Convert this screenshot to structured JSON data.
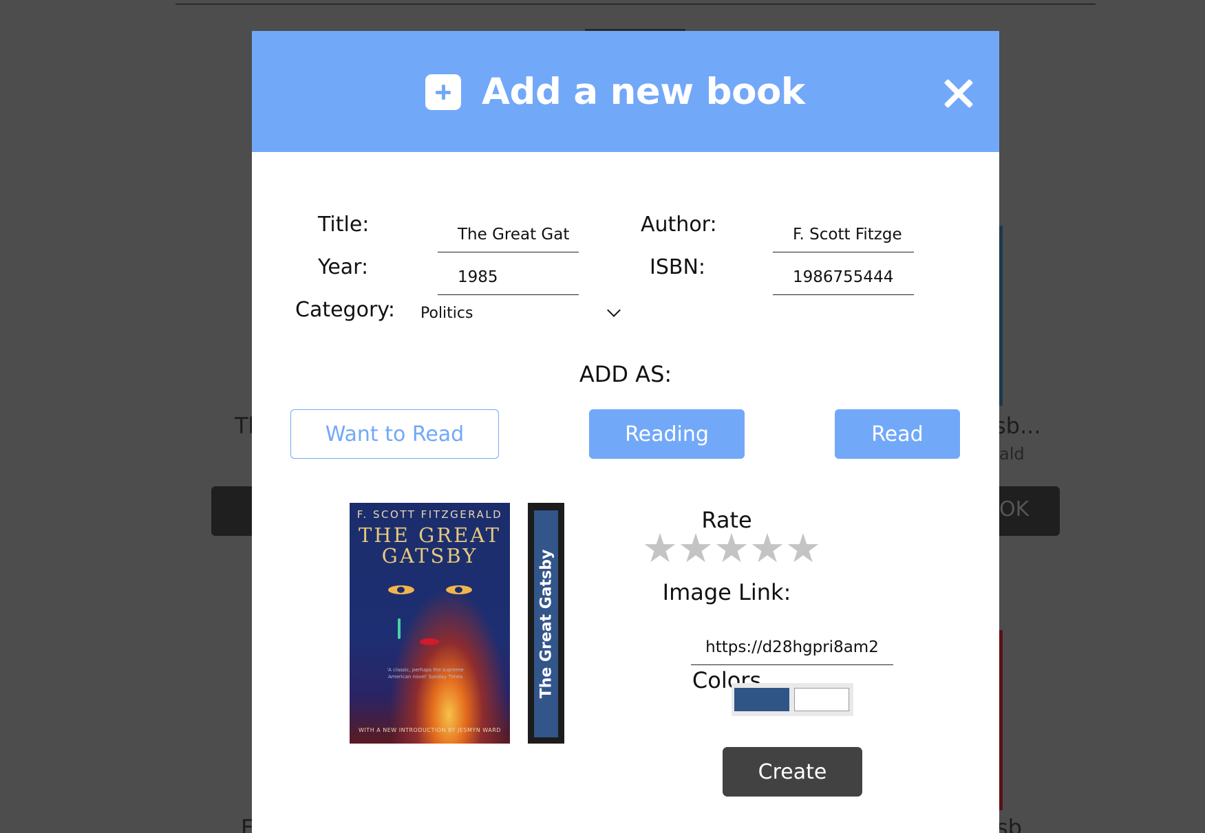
{
  "background": {
    "left_title_fragment": "Th",
    "right_title_fragment": "sb...",
    "right_author_fragment": "ald",
    "right_button_fragment": "OK",
    "bottom_left_fragment": "F",
    "bottom_right_fragment": "sb"
  },
  "modal": {
    "title": "Add a new book",
    "header_icon": "plus-square-icon",
    "close_icon": "close-icon",
    "accent_color": "#72a8f8"
  },
  "form": {
    "title_label": "Title:",
    "title_value": "The Great Gat",
    "author_label": "Author:",
    "author_value": "F. Scott Fitzge",
    "year_label": "Year:",
    "year_value": "1985",
    "isbn_label": "ISBN:",
    "isbn_value": "1986755444",
    "category_label": "Category:",
    "category_value": "Politics"
  },
  "add_as": {
    "label": "ADD AS:",
    "options": [
      "Want to Read",
      "Reading",
      "Read"
    ],
    "selected": "Want to Read"
  },
  "cover": {
    "author": "F. SCOTT FITZGERALD",
    "title": "THE GREAT GATSBY",
    "quote": "'A classic, perhaps the supreme American novel' Sunday Times",
    "intro": "WITH A NEW INTRODUCTION BY JESMYN WARD",
    "spine_title": "The Great Gatsby",
    "spine_color": "#32558a",
    "spine_border_color": "#1c1c1c"
  },
  "rating": {
    "label": "Rate",
    "value": 0,
    "max": 5,
    "star_color": "#c4c4c4"
  },
  "image_link": {
    "label": "Image Link:",
    "value": "https://d28hgpri8am2"
  },
  "colors": {
    "label": "Colors",
    "swatches": [
      "#2f5587",
      "#ffffff"
    ]
  },
  "create_label": "Create"
}
